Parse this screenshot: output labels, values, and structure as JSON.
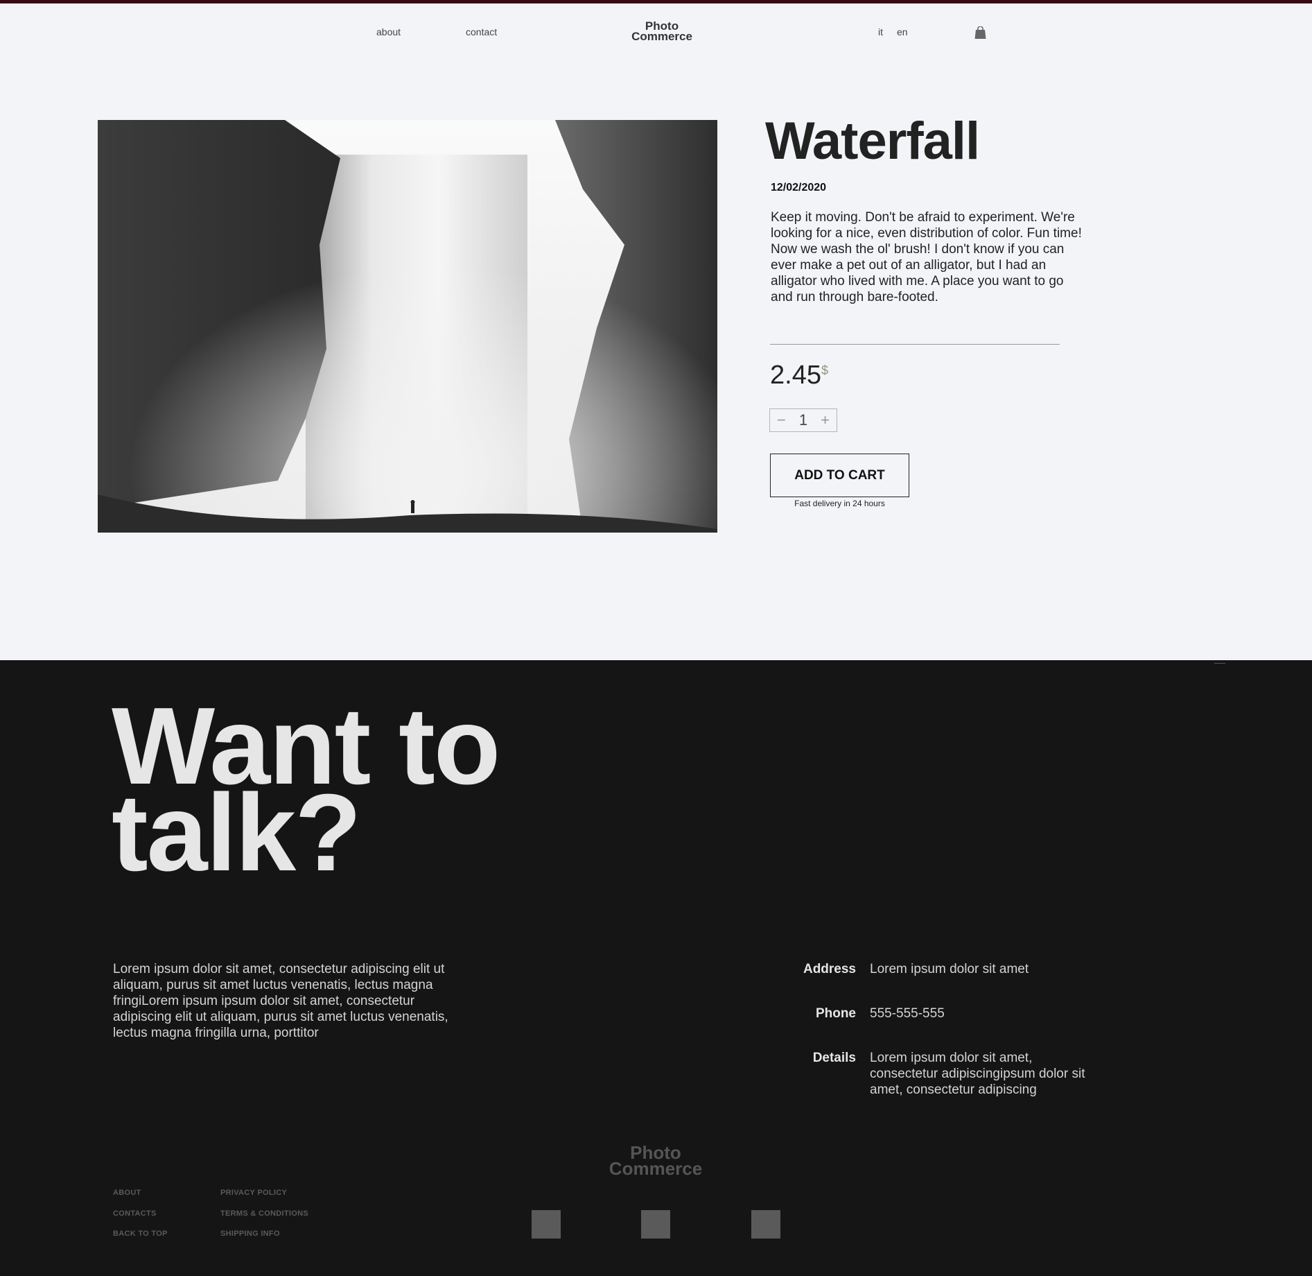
{
  "header": {
    "nav": [
      {
        "label": "about"
      },
      {
        "label": "contact"
      }
    ],
    "logo_line1": "Photo",
    "logo_line2": "Commerce",
    "languages": [
      {
        "label": "it"
      },
      {
        "label": "en"
      }
    ],
    "cart_icon": "shopping-bag-icon"
  },
  "product": {
    "title": "Waterfall",
    "date": "12/02/2020",
    "description": "Keep it moving. Don't be afraid to experiment. We're looking for a nice, even distribution of color. Fun time! Now we wash the ol' brush! I don't know if you can ever make a pet out of an alligator, but I had an alligator who lived with me. A place you want to go and run through bare-footed.",
    "price": "2.45",
    "currency": "$",
    "quantity": "1",
    "minus_label": "−",
    "plus_label": "+",
    "add_to_cart": "ADD TO CART",
    "delivery_note": "Fast delivery in 24 hours"
  },
  "footer": {
    "headline_line1": "Want to",
    "headline_line2": "talk?",
    "lorem": "Lorem ipsum dolor sit amet, consectetur adipiscing elit ut aliquam, purus sit amet luctus venenatis, lectus magna fringiLorem ipsum  ipsum dolor sit amet, consectetur adipiscing elit ut aliquam, purus sit amet luctus venenatis, lectus magna fringilla urna, porttitor",
    "info": [
      {
        "label": "Address",
        "value": "Lorem ipsum dolor sit amet"
      },
      {
        "label": "Phone",
        "value": "555-555-555"
      },
      {
        "label": "Details",
        "value": "Lorem ipsum dolor sit amet, consectetur adipiscingipsum dolor sit amet, consectetur adipiscing"
      }
    ],
    "logo_line1": "Photo",
    "logo_line2": "Commerce",
    "links_col1": [
      {
        "label": "ABOUT"
      },
      {
        "label": "CONTACTS"
      },
      {
        "label": "BACK TO TOP"
      }
    ],
    "links_col2": [
      {
        "label": "PRIVACY POLICY"
      },
      {
        "label": "TERMS & CONDITIONS"
      },
      {
        "label": "SHIPPING INFO"
      }
    ]
  },
  "colors": {
    "background": "#f3f4f7",
    "footer_background": "#151516",
    "top_accent": "#3a0a10",
    "currency": "#8a9a7a"
  }
}
